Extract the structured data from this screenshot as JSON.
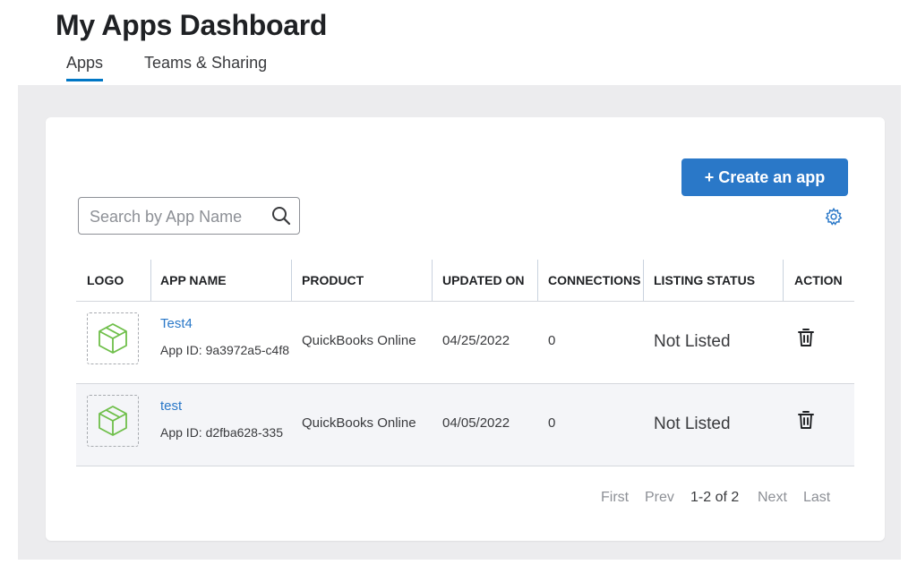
{
  "header": {
    "title": "My Apps Dashboard",
    "tabs": [
      {
        "label": "Apps",
        "active": true
      },
      {
        "label": "Teams & Sharing",
        "active": false
      }
    ]
  },
  "toolbar": {
    "create_label": "+ Create an app",
    "search_placeholder": "Search by App Name",
    "search_value": "",
    "search_icon": "search-icon",
    "settings_icon": "gear-icon"
  },
  "table": {
    "columns": [
      "LOGO",
      "APP NAME",
      "PRODUCT",
      "UPDATED ON",
      "CONNECTIONS",
      "LISTING STATUS",
      "ACTION"
    ],
    "rows": [
      {
        "logo_icon": "cube-icon",
        "name": "Test4",
        "app_id": "App ID: 9a3972a5-c4f8",
        "product": "QuickBooks Online",
        "updated_on": "04/25/2022",
        "connections": "0",
        "listing_status": "Not Listed",
        "action_icon": "trash-icon"
      },
      {
        "logo_icon": "cube-icon",
        "name": "test",
        "app_id": "App ID: d2fba628-335",
        "product": "QuickBooks Online",
        "updated_on": "04/05/2022",
        "connections": "0",
        "listing_status": "Not Listed",
        "action_icon": "trash-icon"
      }
    ]
  },
  "pagination": {
    "first": "First",
    "prev": "Prev",
    "range": "1-2 of 2",
    "next": "Next",
    "last": "Last"
  },
  "colors": {
    "accent": "#2a78c8",
    "tab_underline": "#0077c5",
    "logo_green": "#6fbf4a",
    "background": "#ececee"
  }
}
